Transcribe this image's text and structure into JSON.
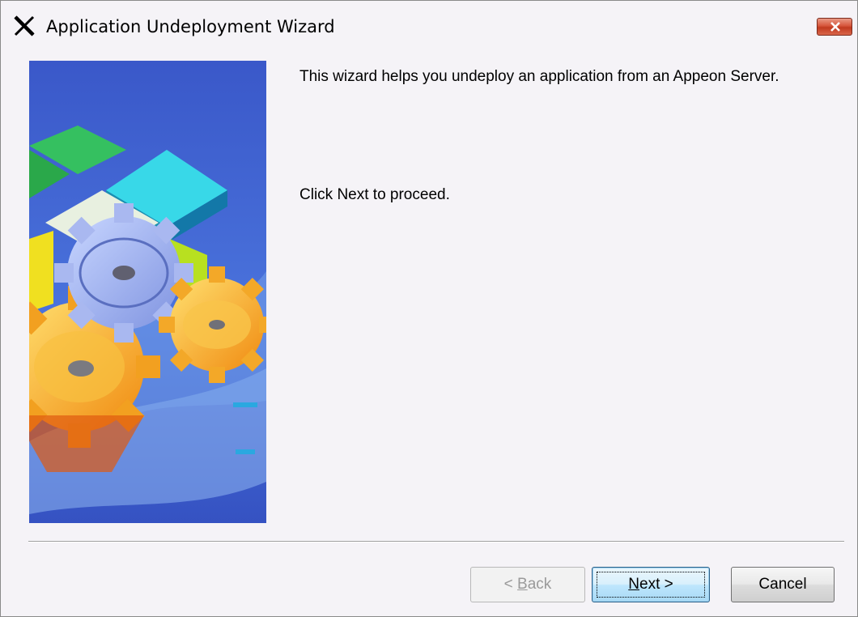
{
  "window": {
    "title": "Application Undeployment Wizard",
    "close_icon": "close-icon",
    "app_icon": "x-logo-icon"
  },
  "content": {
    "intro": "This wizard helps you undeploy an application from an Appeon Server.",
    "proceed": "Click Next to proceed."
  },
  "buttons": {
    "back": {
      "prefix": "< ",
      "mnemonic": "B",
      "rest": "ack",
      "enabled": false
    },
    "next": {
      "mnemonic": "N",
      "rest": "ext >",
      "enabled": true,
      "default": true
    },
    "cancel": {
      "label": "Cancel",
      "enabled": true
    }
  },
  "colors": {
    "image_bg": "#3f5fcf",
    "close_button": "#d6553b",
    "default_button_border": "#2c628b"
  }
}
